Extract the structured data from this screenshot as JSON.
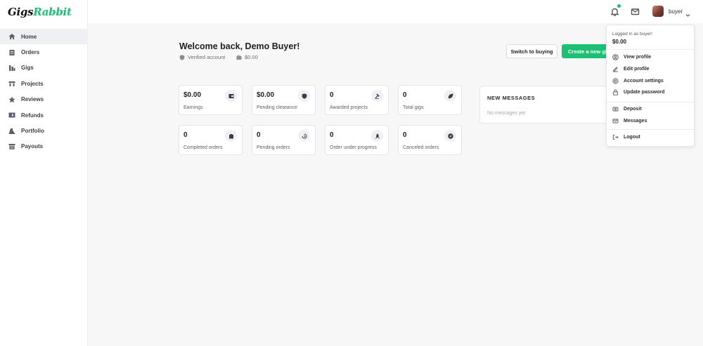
{
  "brand": {
    "logo_primary": "Gigs",
    "logo_accent": "Rabbit",
    "accent_color": "#1dbf73"
  },
  "sidebar": {
    "items": [
      {
        "label": "Home",
        "icon": "home-icon",
        "active": true
      },
      {
        "label": "Orders",
        "icon": "orders-icon",
        "active": false
      },
      {
        "label": "Gigs",
        "icon": "gigs-icon",
        "active": false
      },
      {
        "label": "Projects",
        "icon": "projects-icon",
        "active": false
      },
      {
        "label": "Reviews",
        "icon": "star-icon",
        "active": false
      },
      {
        "label": "Refunds",
        "icon": "refunds-icon",
        "active": false
      },
      {
        "label": "Portfolio",
        "icon": "portfolio-icon",
        "active": false
      },
      {
        "label": "Payouts",
        "icon": "payouts-icon",
        "active": false
      }
    ]
  },
  "header": {
    "username": "buyer",
    "has_notification": true
  },
  "main": {
    "welcome": "Welcome back, Demo Buyer!",
    "verified": "Verified account",
    "balance": "$0.00",
    "switch_label": "Switch to buying",
    "create_label": "Create a new gig",
    "stats": [
      {
        "value": "$0.00",
        "label": "Earnings",
        "icon": "wallet-icon"
      },
      {
        "value": "$0.00",
        "label": "Pending clearance",
        "icon": "shield-icon"
      },
      {
        "value": "0",
        "label": "Awarded projects",
        "icon": "gavel-icon"
      },
      {
        "value": "0",
        "label": "Total gigs",
        "icon": "leaf-icon"
      },
      {
        "value": "0",
        "label": "Completed orders",
        "icon": "bag-check-icon"
      },
      {
        "value": "0",
        "label": "Pending orders",
        "icon": "history-icon"
      },
      {
        "value": "0",
        "label": "Order under progress",
        "icon": "rocket-icon"
      },
      {
        "value": "0",
        "label": "Canceled orders",
        "icon": "compass-icon"
      }
    ],
    "messages": {
      "title": "NEW MESSAGES",
      "empty": "No messages yet"
    }
  },
  "dropdown": {
    "logged_in_as": "Logged in as buyer!",
    "balance": "$0.00",
    "items": [
      {
        "label": "View profile",
        "icon": "user-circle-icon"
      },
      {
        "label": "Edit profile",
        "icon": "edit-icon"
      },
      {
        "label": "Account settings",
        "icon": "settings-icon"
      },
      {
        "label": "Update password",
        "icon": "lock-icon"
      },
      {
        "label": "Deposit",
        "icon": "deposit-icon"
      },
      {
        "label": "Messages",
        "icon": "mail-icon"
      },
      {
        "label": "Logout",
        "icon": "logout-icon"
      }
    ]
  }
}
